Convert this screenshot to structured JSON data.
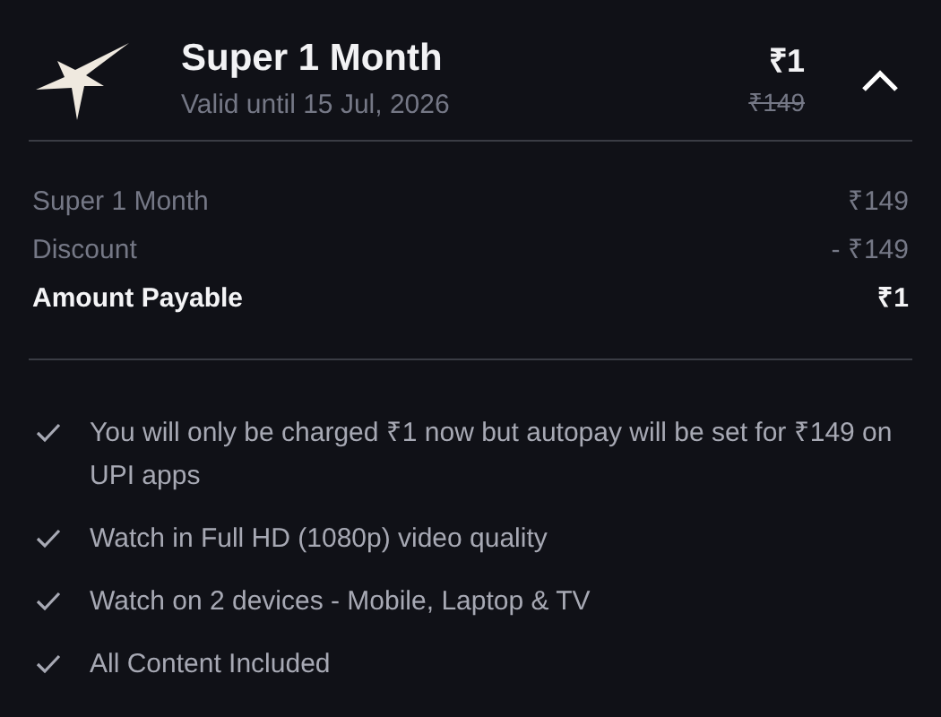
{
  "plan": {
    "title": "Super 1 Month",
    "validity": "Valid until 15 Jul, 2026",
    "price": "₹1",
    "original_price": "₹149",
    "expanded": true
  },
  "breakdown": [
    {
      "label": "Super 1 Month",
      "amount": "₹149",
      "kind": "line"
    },
    {
      "label": "Discount",
      "amount": "- ₹149",
      "kind": "line"
    },
    {
      "label": "Amount Payable",
      "amount": "₹1",
      "kind": "total"
    }
  ],
  "benefits": [
    "You will only be charged ₹1 now but autopay will be set for ₹149 on UPI apps",
    "Watch in Full HD (1080p) video quality",
    "Watch on 2 devices - Mobile, Laptop & TV",
    "All Content Included"
  ]
}
